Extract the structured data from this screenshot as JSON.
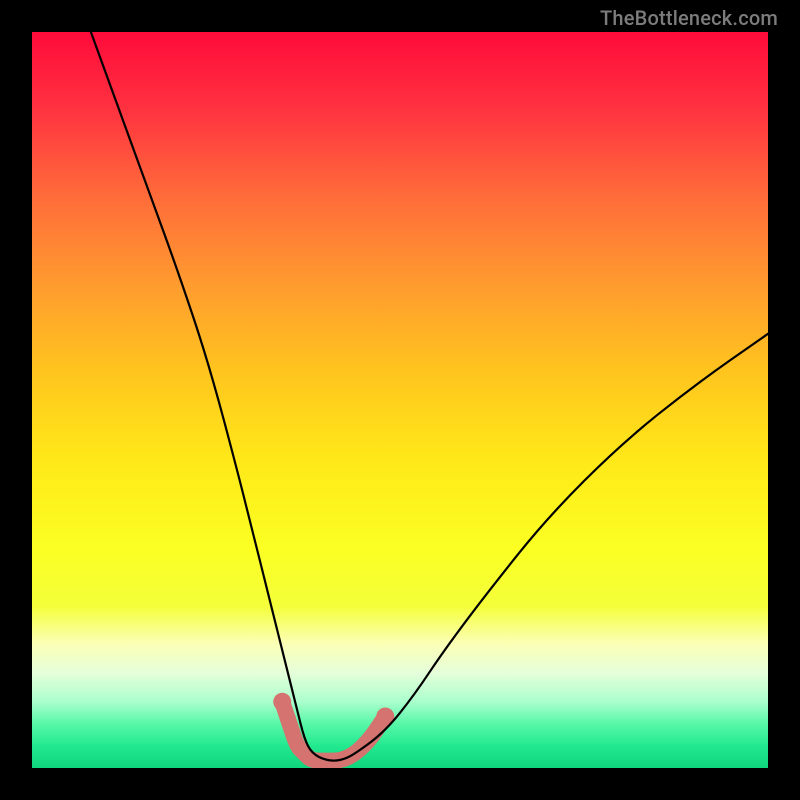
{
  "watermark": "TheBottleneck.com",
  "chart_data": {
    "type": "line",
    "title": "",
    "xlabel": "",
    "ylabel": "",
    "xlim": [
      0,
      100
    ],
    "ylim": [
      0,
      100
    ],
    "series": [
      {
        "name": "bottleneck-curve",
        "x_pct": [
          8,
          12,
          16,
          20,
          24,
          28,
          30,
          32,
          34,
          36,
          37,
          38,
          40,
          42,
          44,
          48,
          52,
          56,
          62,
          70,
          80,
          90,
          100
        ],
        "y_pct": [
          100,
          89,
          78,
          67,
          55,
          40,
          32,
          24,
          16,
          8,
          4,
          2,
          1,
          1,
          2,
          5,
          10,
          16,
          24,
          34,
          44,
          52,
          59
        ],
        "stroke": "#000000",
        "stroke_width": 2
      },
      {
        "name": "optimal-zone-overlay",
        "x_pct": [
          34,
          35,
          36,
          37,
          38,
          40,
          42,
          44,
          46,
          48
        ],
        "y_pct": [
          9,
          6,
          3,
          2,
          1,
          1,
          1,
          2,
          4,
          7
        ],
        "stroke": "#d4736f",
        "stroke_width": 16
      }
    ],
    "gradient_bands_note": "Background gradient encodes bottleneck severity: red (high) at top, green (optimal) at bottom."
  }
}
